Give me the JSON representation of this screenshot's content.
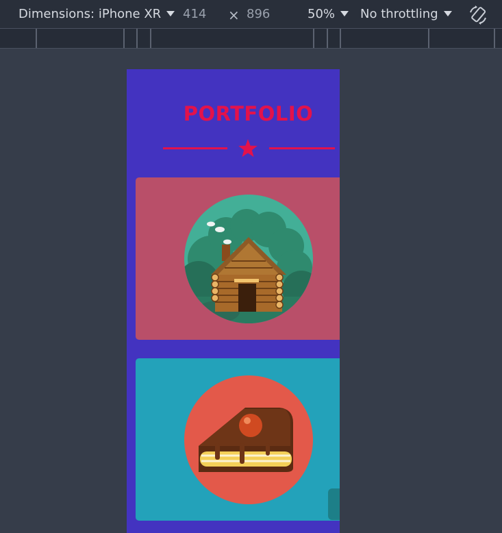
{
  "devtools": {
    "device_label": "Dimensions: iPhone XR",
    "width_value": "414",
    "height_value": "896",
    "times_symbol": "×",
    "zoom_label": "50%",
    "throttling_label": "No throttling"
  },
  "page": {
    "title": "PORTFOLIO",
    "cards": [
      {
        "image": "log-cabin-illustration",
        "background": "#b94f69"
      },
      {
        "image": "cake-slice-illustration",
        "background": "#23a2ba"
      }
    ]
  },
  "colors": {
    "page_background": "#4333c0",
    "accent": "#e3124b",
    "devtools_bg": "#292f3a"
  },
  "icons": {
    "device_dropdown": "chevron-down-icon",
    "rotate": "rotate-device-icon",
    "divider": "star-icon"
  }
}
